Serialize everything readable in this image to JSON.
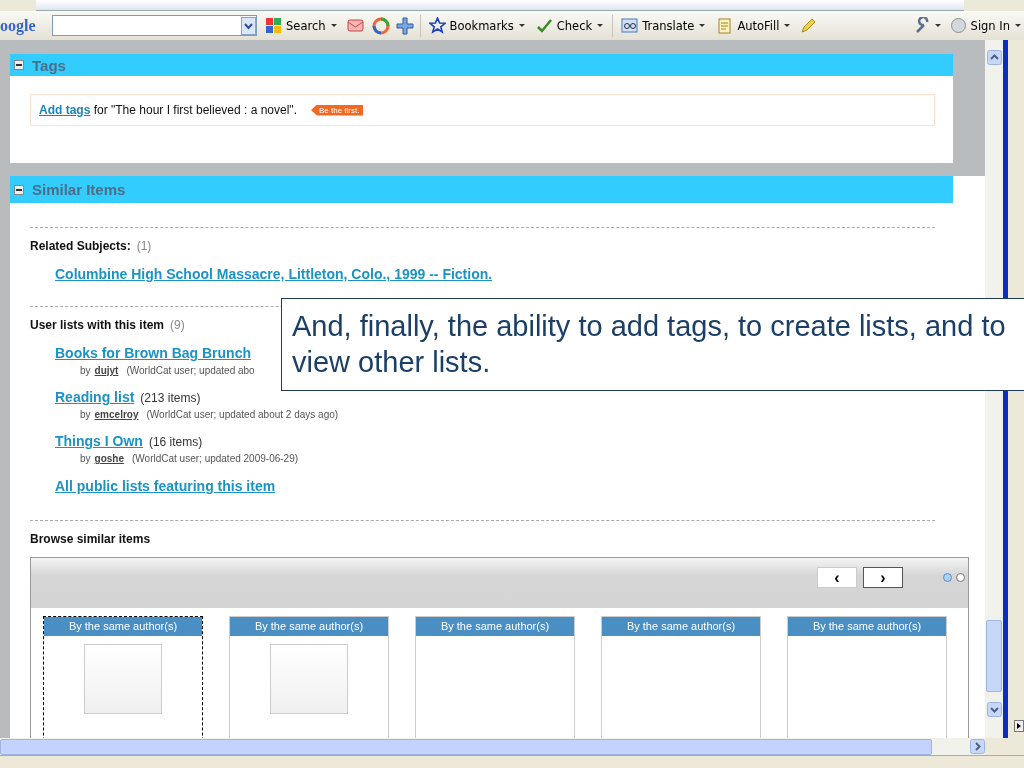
{
  "toolbar": {
    "logo": "oogle",
    "items": [
      {
        "label": "Search"
      },
      {
        "label": "Bookmarks"
      },
      {
        "label": "Check"
      },
      {
        "label": "Translate"
      },
      {
        "label": "AutoFill"
      },
      {
        "label": "Sign In"
      }
    ]
  },
  "tags": {
    "title": "Tags",
    "link": "Add tags",
    "text": "for \"The hour I first believed : a novel\".",
    "badge": "Be the first."
  },
  "similar": {
    "title": "Similar Items",
    "related": {
      "label": "Related Subjects:",
      "count": "(1)",
      "links": [
        "Columbine High School Massacre, Littleton, Colo., 1999 -- Fiction."
      ]
    },
    "user_lists": {
      "label": "User lists with this item",
      "count": "(9)",
      "lists": [
        {
          "title": "Books for Brown Bag Brunch",
          "by": "by",
          "user": "dujyt",
          "meta": "(WorldCat user; updated abo"
        },
        {
          "title": "Reading list",
          "count": "(213 items)",
          "by": "by",
          "user": "emcelroy",
          "meta": "(WorldCat user; updated about 2 days ago)"
        },
        {
          "title": "Things I Own",
          "count": "(16 items)",
          "by": "by",
          "user": "goshe",
          "meta": "(WorldCat user; updated 2009-06-29)"
        }
      ],
      "all_link": "All public lists featuring this item"
    },
    "browse": {
      "label": "Browse similar items",
      "prev": "‹",
      "next": "›",
      "pages": [
        {
          "selected": true
        },
        {
          "selected": false
        }
      ],
      "cards": [
        {
          "label": "By the same author(s)",
          "selected": true,
          "kind": "cover"
        },
        {
          "label": "By the same author(s)",
          "selected": false,
          "kind": "cover"
        },
        {
          "label": "By the same author(s)",
          "selected": false,
          "kind": "empty"
        },
        {
          "label": "By the same author(s)",
          "selected": false,
          "kind": "empty"
        },
        {
          "label": "By the same author(s)",
          "selected": false,
          "kind": "empty"
        }
      ]
    }
  },
  "callout": {
    "text": "And, finally, the ability to add tags, to create lists, and to view other lists."
  }
}
